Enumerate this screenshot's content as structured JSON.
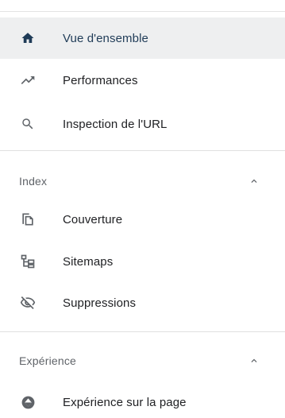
{
  "nav": {
    "items": [
      {
        "id": "overview",
        "label": "Vue d'ensemble",
        "icon": "home-icon",
        "active": true
      },
      {
        "id": "performance",
        "label": "Performances",
        "icon": "trending-up-icon",
        "active": false
      },
      {
        "id": "url-inspection",
        "label": "Inspection de l'URL",
        "icon": "search-icon",
        "active": false
      }
    ],
    "index_section": {
      "label": "Index",
      "expanded": true,
      "items": [
        {
          "id": "coverage",
          "label": "Couverture",
          "icon": "copy-pages-icon"
        },
        {
          "id": "sitemaps",
          "label": "Sitemaps",
          "icon": "sitemap-icon"
        },
        {
          "id": "removals",
          "label": "Suppressions",
          "icon": "eye-off-icon"
        }
      ]
    },
    "experience_section": {
      "label": "Expérience",
      "expanded": true,
      "items": [
        {
          "id": "page-experience",
          "label": "Expérience sur la page",
          "icon": "page-experience-icon"
        }
      ]
    }
  },
  "colors": {
    "active_bg": "#eeeff0",
    "active_icon": "#1f3b57",
    "icon": "#5f6368",
    "text": "#202124",
    "section_text": "#5f6368",
    "divider": "#e0e0e0"
  }
}
